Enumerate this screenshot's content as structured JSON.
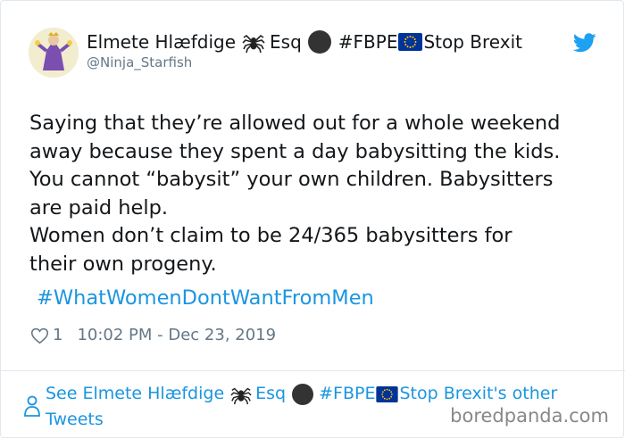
{
  "tweet": {
    "author": {
      "name_parts": [
        "Elmete Hlæfdige",
        "Esq",
        "#FBPE",
        "Stop Brexit"
      ],
      "handle": "@Ninja_Starfish"
    },
    "text_lines": [
      "Saying that they’re allowed out for a whole weekend",
      "away because they spent a day babysitting the kids.",
      "You cannot “babysit” your own children. Babysitters",
      "are paid help.",
      "Women don’t claim to be 24/365 babysitters for",
      "their own progeny."
    ],
    "hashtag": "#WhatWomenDontWantFromMen",
    "likes": "1",
    "timestamp": "10:02 PM - Dec 23, 2019"
  },
  "footer": {
    "prefix": "See Elmete Hlæfdige",
    "esq": "Esq",
    "fbpe": "#FBPE",
    "suffix": "Stop Brexit's other",
    "line2": "Tweets"
  },
  "watermark": "boredpanda.com",
  "colors": {
    "link": "#1b95e0",
    "secondary_text": "#657786",
    "border": "#e1e8ed",
    "eu_flag": "#003399",
    "eu_star": "#ffcc00"
  },
  "icons": [
    "avatar",
    "spider-icon",
    "black-circle-icon",
    "eu-flag-icon",
    "twitter-bird-icon",
    "heart-icon",
    "person-icon"
  ]
}
